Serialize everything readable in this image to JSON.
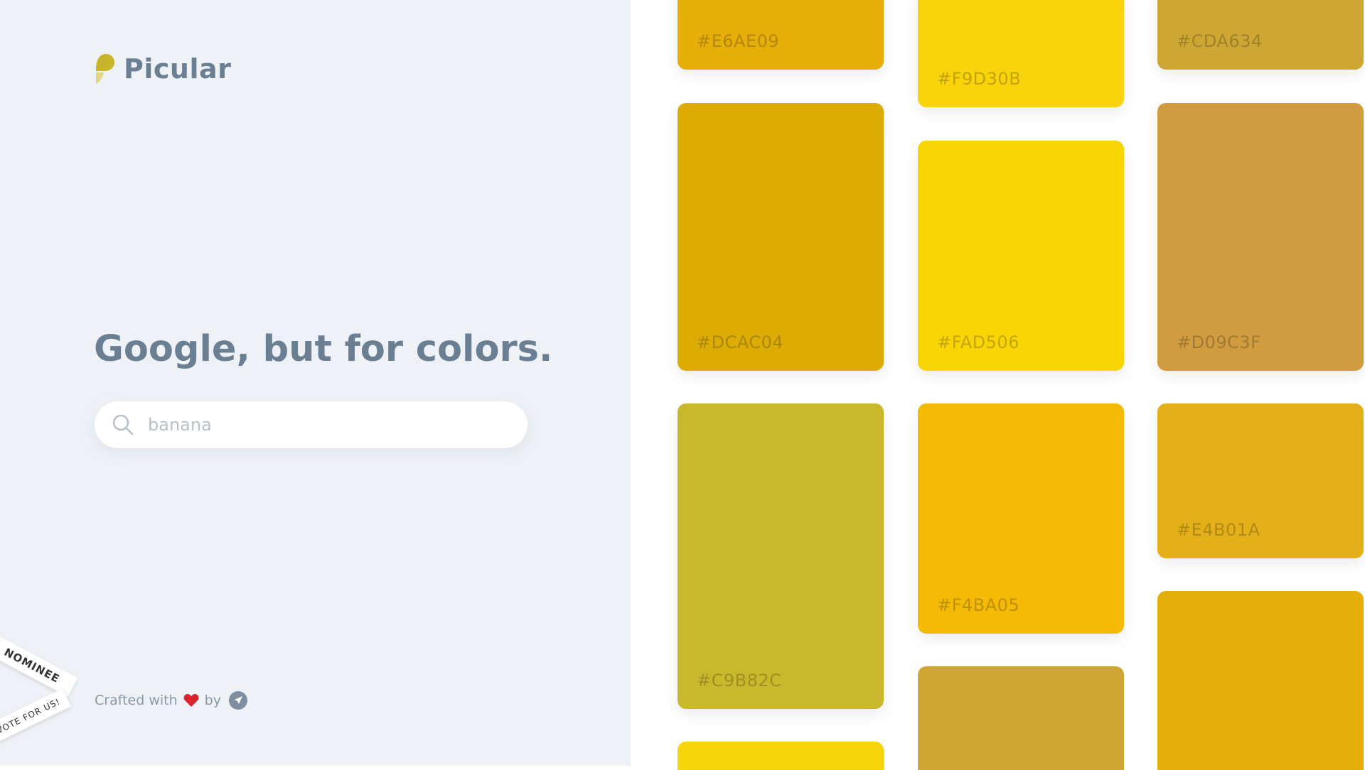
{
  "logo": {
    "name": "Picular"
  },
  "headline": "Google, but for colors.",
  "search": {
    "value": "banana"
  },
  "footer": {
    "crafted_text": "Crafted with",
    "by_text": "by"
  },
  "ribbons": {
    "nominee": "NOMINEE",
    "vote": "VOTE FOR US!"
  },
  "swatches": [
    {
      "hex": "#E6AE09",
      "color": "#E6AE09"
    },
    {
      "hex": "#F9D30B",
      "color": "#F9D30B"
    },
    {
      "hex": "#CDA634",
      "color": "#CDA634"
    },
    {
      "hex": "#DCAC04",
      "color": "#DCAC04"
    },
    {
      "hex": "#FAD506",
      "color": "#FAD506"
    },
    {
      "hex": "#D09C3F",
      "color": "#D09C3F"
    },
    {
      "hex": "#C9B82C",
      "color": "#C9B82C"
    },
    {
      "hex": "#F4BA05",
      "color": "#F4BA05"
    },
    {
      "hex": "#E4B01A",
      "color": "#E4B01A"
    },
    {
      "hex": "",
      "color": "#F8D40B"
    },
    {
      "hex": "",
      "color": "#CEA634"
    },
    {
      "hex": "",
      "color": "#E4AF0B"
    }
  ]
}
